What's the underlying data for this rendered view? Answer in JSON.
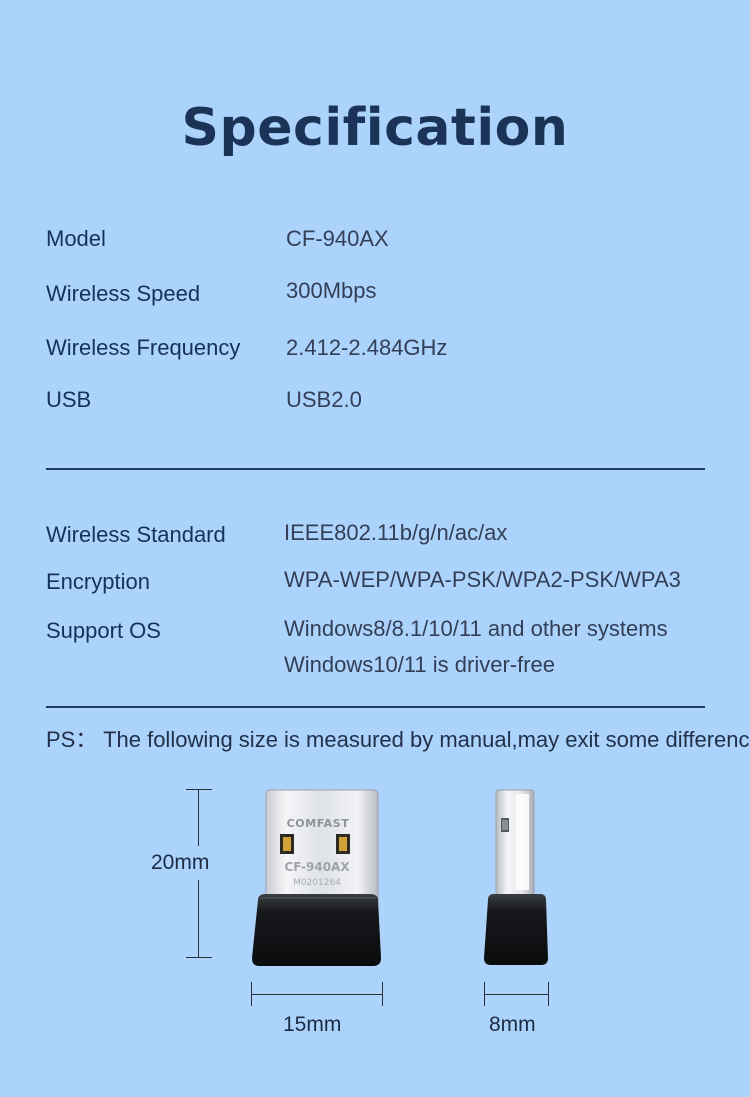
{
  "title": "Specification",
  "specs_group1": [
    {
      "label": "Model",
      "value": "CF-940AX"
    },
    {
      "label": "Wireless Speed",
      "value": "300Mbps"
    },
    {
      "label": "Wireless Frequency",
      "value": "2.412-2.484GHz"
    },
    {
      "label": "USB",
      "value": "USB2.0"
    }
  ],
  "specs_group2": [
    {
      "label": "Wireless Standard",
      "value": "IEEE802.11b/g/n/ac/ax"
    },
    {
      "label": "Encryption",
      "value": "WPA-WEP/WPA-PSK/WPA2-PSK/WPA3"
    },
    {
      "label": "Support OS",
      "value": "Windows8/8.1/10/11 and other systems",
      "value_line2": "Windows10/11 is driver-free"
    }
  ],
  "ps_note": "PS： The following size is measured by manual,may exit some difference",
  "product": {
    "brand": "COMFAST",
    "model_print": "CF-940AX",
    "serial_print": "M0201264"
  },
  "dimensions": {
    "height": "20mm",
    "width": "15mm",
    "thickness": "8mm"
  },
  "colors": {
    "background": "#acd3fb",
    "title": "#1b3356",
    "divider": "#1e3a6b"
  }
}
